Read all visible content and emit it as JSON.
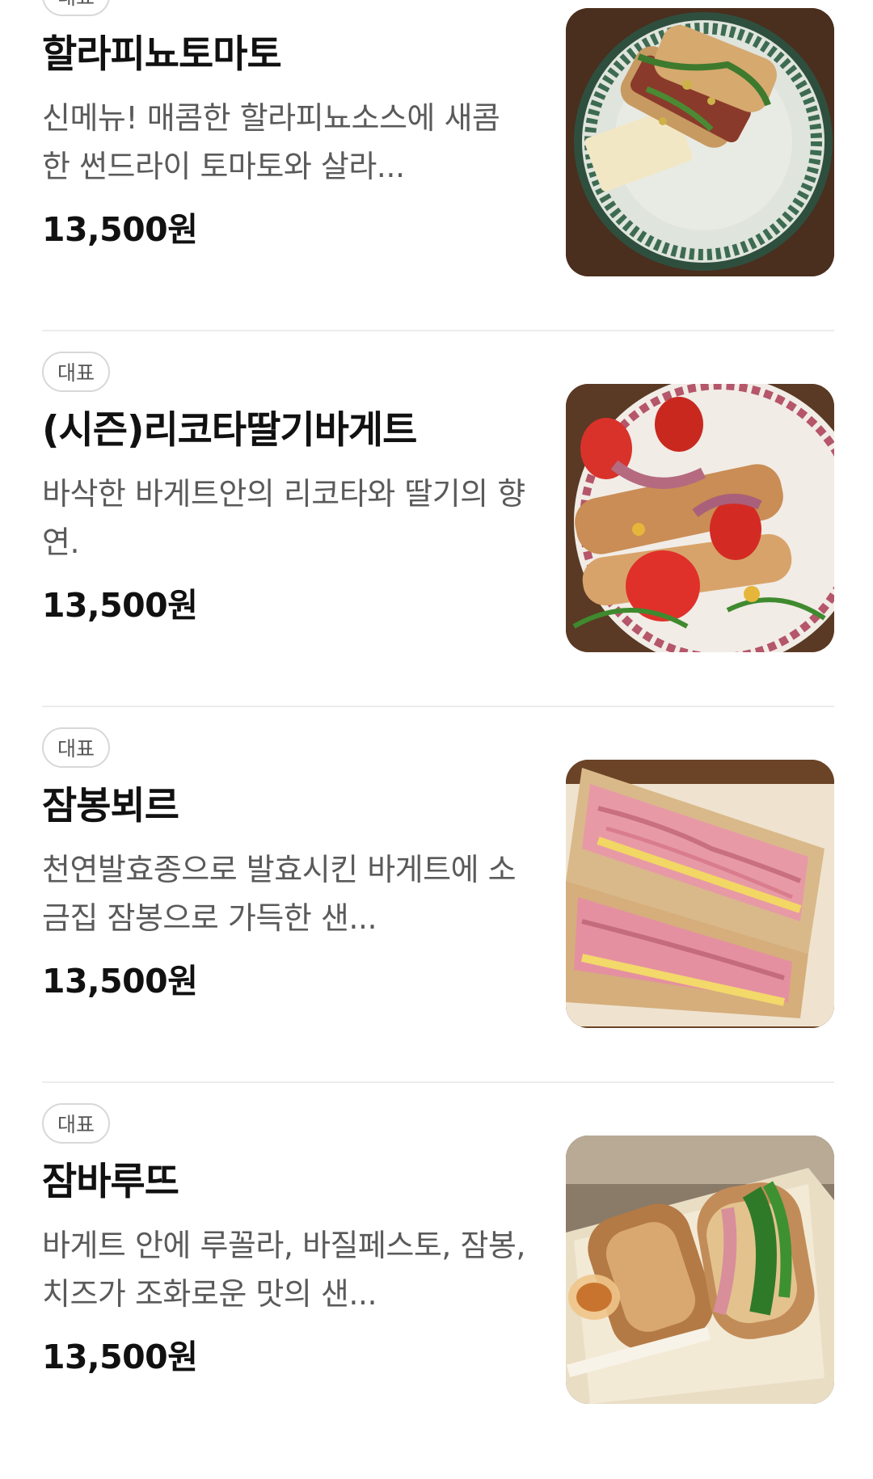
{
  "menu": {
    "items": [
      {
        "badge": "대표",
        "name": "할라피뇨토마토",
        "description": "신메뉴! 매콤한 할라피뇨소스에 새콤한 썬드라이 토마토와 살라...",
        "price": "13,500원",
        "image_icon": "sandwich-on-green-plate-photo"
      },
      {
        "badge": "대표",
        "name": "(시즌)리코타딸기바게트",
        "description": "바삭한 바게트안의 리코타와 딸기의 향연.",
        "price": "13,500원",
        "image_icon": "strawberry-baguette-photo"
      },
      {
        "badge": "대표",
        "name": "잠봉뵈르",
        "description": "천연발효종으로 발효시킨 바게트에 소금집 잠봉으로 가득한 샌...",
        "price": "13,500원",
        "image_icon": "ham-butter-sandwich-photo"
      },
      {
        "badge": "대표",
        "name": "잠바루뜨",
        "description": "바게트 안에 루꼴라, 바질페스토, 잠봉, 치즈가 조화로운 맛의 샌...",
        "price": "13,500원",
        "image_icon": "arugula-ham-sandwich-photo"
      }
    ]
  },
  "colors": {
    "text_primary": "#111111",
    "text_secondary": "#5a5a5a",
    "badge_border": "#d8d8d8",
    "divider": "#ececec"
  }
}
